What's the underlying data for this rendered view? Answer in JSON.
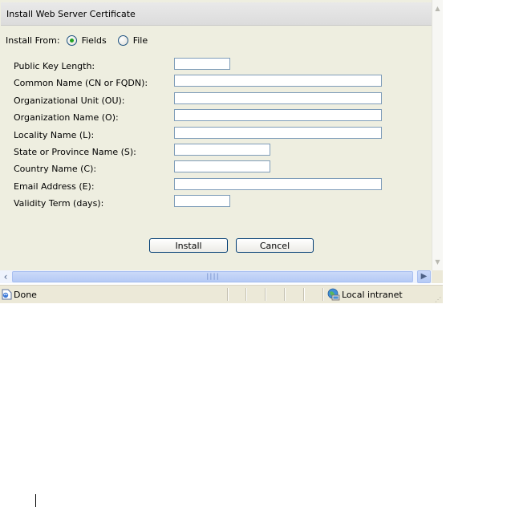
{
  "page": {
    "title": "Install Web Server Certificate"
  },
  "install_from": {
    "label": "Install From:",
    "options": [
      {
        "label": "Fields",
        "checked": true
      },
      {
        "label": "File",
        "checked": false
      }
    ]
  },
  "fields": [
    {
      "label": "Public Key Length:",
      "value": ""
    },
    {
      "label": "Common Name (CN or FQDN):",
      "value": ""
    },
    {
      "label": "Organizational Unit (OU):",
      "value": ""
    },
    {
      "label": "Organization Name (O):",
      "value": ""
    },
    {
      "label": "Locality Name (L):",
      "value": ""
    },
    {
      "label": "State or Province Name (S):",
      "value": ""
    },
    {
      "label": "Country Name (C):",
      "value": ""
    },
    {
      "label": "Email Address (E):",
      "value": ""
    },
    {
      "label": "Validity Term (days):",
      "value": ""
    }
  ],
  "buttons": {
    "install": "Install",
    "cancel": "Cancel"
  },
  "statusbar": {
    "status": "Done",
    "zone": "Local intranet"
  },
  "icons": {
    "page": "page-done-icon",
    "zone": "globe-computer-icon",
    "scroll_up": "scroll-up-arrow-icon",
    "scroll_down": "scroll-down-arrow-icon",
    "scroll_left": "scroll-left-arrow-icon",
    "scroll_right": "scroll-right-arrow-icon"
  },
  "colors": {
    "content_background": "#eeeee0",
    "header_background": "#dcdcdc",
    "radio_checked": "#21a121",
    "scrollbar_thumb": "#b5caf5",
    "statusbar_background": "#ece9d8"
  }
}
